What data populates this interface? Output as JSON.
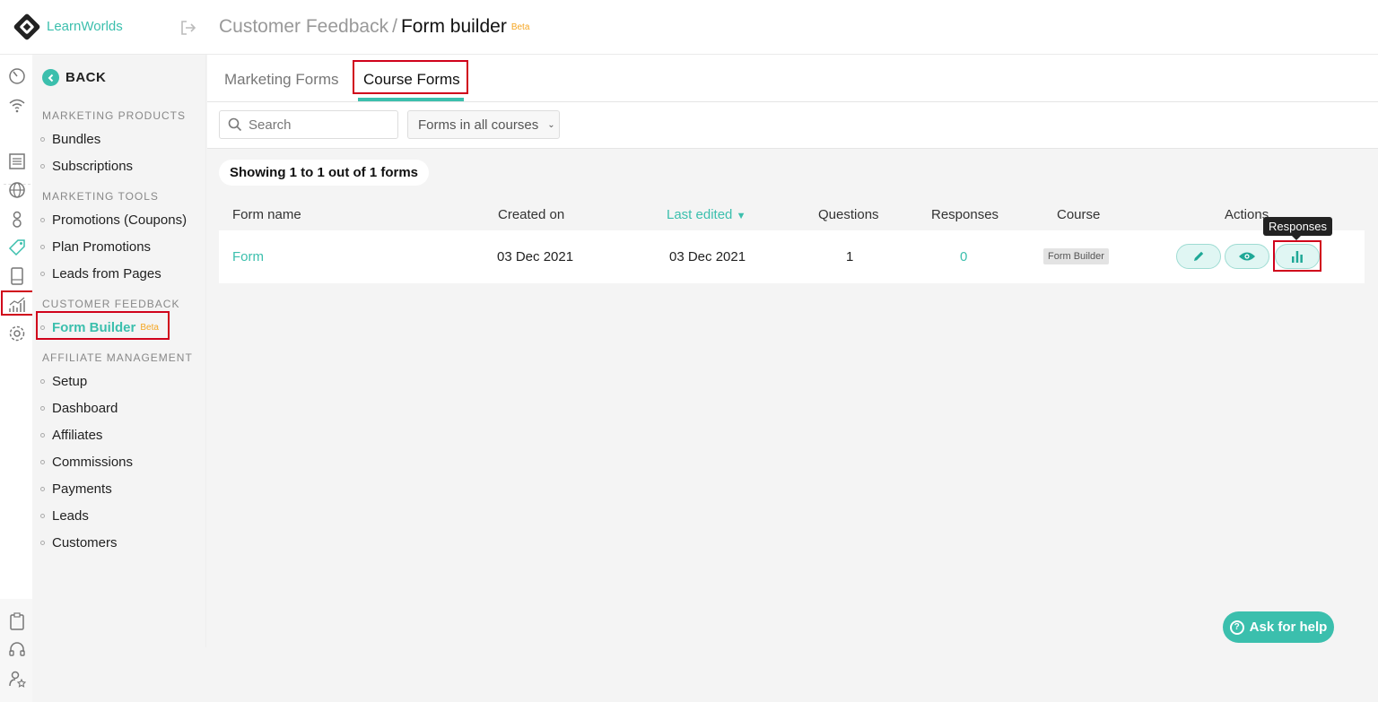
{
  "brand": {
    "name": "LearnWorlds",
    "accent": "#3bbfad",
    "highlight": "#d0021b",
    "beta_color": "#f5a623"
  },
  "header": {
    "crumb": "Customer Feedback",
    "separator": "/",
    "current": "Form builder",
    "badge": "Beta"
  },
  "sidebar": {
    "back_label": "BACK",
    "sections": [
      {
        "title": "MARKETING PRODUCTS",
        "items": [
          "Bundles",
          "Subscriptions"
        ]
      },
      {
        "title": "MARKETING TOOLS",
        "items": [
          "Promotions (Coupons)",
          "Plan Promotions",
          "Leads from Pages"
        ]
      },
      {
        "title": "CUSTOMER FEEDBACK",
        "items": [
          "Form Builder"
        ],
        "active_badge": "Beta"
      },
      {
        "title": "AFFILIATE MANAGEMENT",
        "items": [
          "Setup",
          "Dashboard",
          "Affiliates",
          "Commissions",
          "Payments",
          "Leads",
          "Customers"
        ]
      }
    ]
  },
  "rail_icons": [
    "speedometer-icon",
    "wifi-icon",
    "pages-icon",
    "globe-icon",
    "users-icon",
    "tag-icon",
    "mobile-icon",
    "analytics-icon",
    "settings-icon",
    "clipboard-icon",
    "headset-icon",
    "user-star-icon"
  ],
  "tabs": [
    {
      "label": "Marketing Forms",
      "active": false
    },
    {
      "label": "Course Forms",
      "active": true
    }
  ],
  "filters": {
    "search_placeholder": "Search",
    "course_select": "Forms in all courses"
  },
  "count_text": "Showing 1 to 1 out of 1 forms",
  "table": {
    "columns": [
      "Form name",
      "Created on",
      "Last edited",
      "Questions",
      "Responses",
      "Course",
      "Actions"
    ],
    "sort_column": "Last edited",
    "sort_arrow": "▼",
    "rows": [
      {
        "name": "Form",
        "created": "03 Dec 2021",
        "edited": "03 Dec 2021",
        "questions": "1",
        "responses": "0",
        "course": "Form Builder"
      }
    ],
    "actions": [
      "edit-icon",
      "eye-icon",
      "bar-chart-icon"
    ]
  },
  "tooltip": "Responses",
  "help_button": {
    "label": "Ask for help",
    "glyph": "?"
  }
}
